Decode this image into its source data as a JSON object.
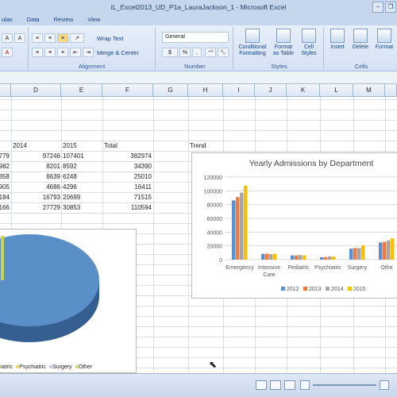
{
  "window": {
    "title": "IL_Excel2013_UD_P1a_LauraJackson_1 - Microsoft Excel"
  },
  "menu_tabs": [
    "ulas",
    "Data",
    "Review",
    "View"
  ],
  "ribbon": {
    "wrap_text": "Wrap Text",
    "merge_center": "Merge & Center",
    "number_format": "General",
    "alignment_label": "Alignment",
    "number_label": "Number",
    "styles_label": "Styles",
    "cells_label": "Cells",
    "conditional_formatting": "Conditional Formatting",
    "format_as_table": "Format as Table",
    "cell_styles": "Cell Styles",
    "insert": "Insert",
    "delete": "Delete",
    "format": "Format",
    "dollar": "$",
    "percent": "%",
    "comma": ","
  },
  "columns": [
    "D",
    "E",
    "F",
    "G",
    "H",
    "I",
    "J",
    "K",
    "L",
    "M"
  ],
  "cells": {
    "h2014": "2014",
    "h2015": "2015",
    "total": "Total",
    "trend": "Trend",
    "rows": [
      {
        "c": "779",
        "d": "97246",
        "e": "107401",
        "f": "382974"
      },
      {
        "c": "982",
        "d": "8201",
        "e": "8592",
        "f": "34390"
      },
      {
        "c": "858",
        "d": "6639",
        "e": "6248",
        "f": "25010"
      },
      {
        "c": "905",
        "d": "4686",
        "e": "4296",
        "f": "16411"
      },
      {
        "c": "184",
        "d": "16793",
        "e": "20699",
        "f": "71515"
      },
      {
        "c": "166",
        "d": "27729",
        "e": "30853",
        "f": "110594"
      }
    ]
  },
  "pie_legend": [
    "iatric",
    "Psychiatric",
    "Surgery",
    "Other"
  ],
  "pie_legend_colors": [
    "#9bbb59",
    "#f7c942",
    "#b8c3d6",
    "#c7d64a"
  ],
  "chart_data": {
    "type": "bar",
    "title": "Yearly Admissions by Department",
    "categories": [
      "Emergency",
      "Intensive Care",
      "Pediatric",
      "Psychiatric",
      "Surgery",
      "Othe"
    ],
    "series": [
      {
        "name": "2012",
        "color": "#5b8fd0",
        "values": [
          86000,
          8500,
          6100,
          3600,
          16000,
          25000
        ]
      },
      {
        "name": "2013",
        "color": "#f07b3f",
        "values": [
          91000,
          8700,
          6200,
          3800,
          17000,
          25800
        ]
      },
      {
        "name": "2014",
        "color": "#a5a5a5",
        "values": [
          97246,
          8201,
          6639,
          4686,
          16793,
          27729
        ]
      },
      {
        "name": "2015",
        "color": "#ffc000",
        "values": [
          107401,
          8592,
          6248,
          4296,
          20699,
          30853
        ]
      }
    ],
    "yticks": [
      "0",
      "20000",
      "40000",
      "60000",
      "80000",
      "100000",
      "120000"
    ],
    "ylim": [
      0,
      120000
    ],
    "legend": "bottom",
    "grid": true
  }
}
